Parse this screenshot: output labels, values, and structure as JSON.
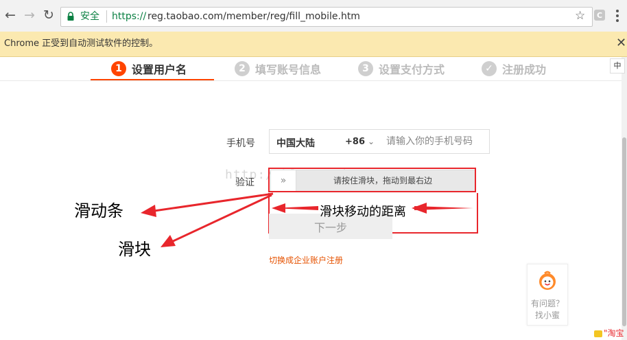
{
  "browser": {
    "secure_label": "安全",
    "url_scheme": "https://",
    "url_rest": "reg.taobao.com/member/reg/fill_mobile.htm",
    "extension_label": "C",
    "infobar_text": "Chrome 正受到自动测试软件的控制。",
    "infobar_close": "✕"
  },
  "steps": [
    {
      "number": "1",
      "label": "设置用户名"
    },
    {
      "number": "2",
      "label": "填写账号信息"
    },
    {
      "number": "3",
      "label": "设置支付方式"
    },
    {
      "number": "✓",
      "label": "注册成功"
    }
  ],
  "lang_toggle": "中",
  "form": {
    "phone_label": "手机号",
    "country_name": "中国大陆",
    "country_code": "+86",
    "phone_placeholder": "请输入你的手机号码",
    "verify_label": "验证",
    "slider_handle": "»",
    "slider_text": "请按住滑块，拖动到最右边",
    "next_button": "下一步",
    "enterprise_link": "切换成企业账户注册"
  },
  "annotations": {
    "distance": "滑块移动的距离",
    "slider_bar": "滑动条",
    "slider_block": "滑块",
    "watermark": "http://blog.csdn.net/QQ2531"
  },
  "help": {
    "line1": "有问题？",
    "line2": "找小蜜"
  },
  "badge": "\"淘宝",
  "colors": {
    "accent": "#ff4400",
    "annotation_red": "#e8262c",
    "secure_green": "#0b8043",
    "infobar_bg": "#fbe9b0"
  }
}
